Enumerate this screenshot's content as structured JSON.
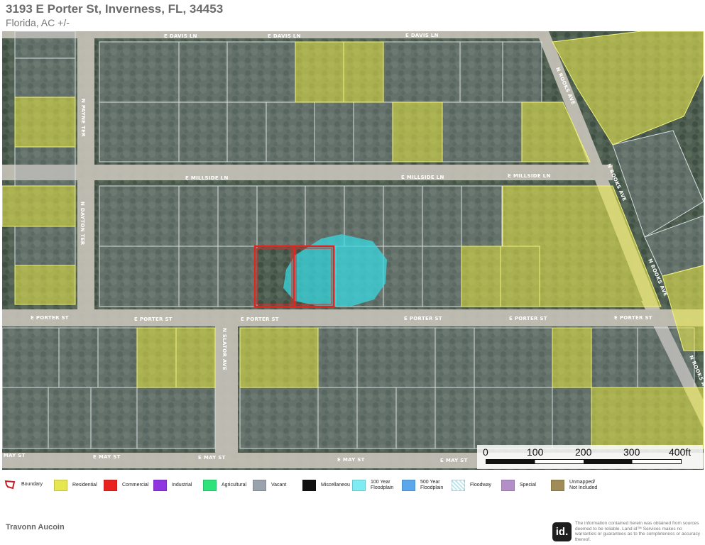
{
  "header": {
    "title": "3193 E Porter St, Inverness, FL, 34453",
    "subtitle": "Florida,  AC +/-"
  },
  "roads": {
    "davis_1": "E DAVIS LN",
    "davis_2": "E DAVIS LN",
    "davis_3": "E DAVIS LN",
    "millside_1": "E MILLSIDE LN",
    "millside_2": "E MILLSIDE LN",
    "millside_3": "E MILLSIDE LN",
    "porter_1": "E PORTER ST",
    "porter_2": "E PORTER ST",
    "porter_3": "E PORTER ST",
    "porter_4": "E PORTER ST",
    "porter_5": "E PORTER ST",
    "porter_6": "E PORTER ST",
    "may_1": "E MAY ST",
    "may_2": "E MAY ST",
    "may_3": "E MAY ST",
    "may_4": "E MAY ST",
    "payne": "N PAYNE TER",
    "dayton": "N DAYTON TER",
    "slator": "N SLATOR AVE",
    "rooks_1": "N ROOKS AVE",
    "rooks_2": "N ROOKS AVE",
    "rooks_3": "N ROOKS AVE",
    "rooks_4": "N ROOKS AVE"
  },
  "scale": {
    "ticks": [
      "0",
      "100",
      "200",
      "300",
      "400ft"
    ]
  },
  "legend": {
    "items": [
      {
        "label": "Boundary",
        "color": "#ffffff",
        "icon": "boundary-polygon-icon"
      },
      {
        "label": "Residential",
        "color": "#e6e650"
      },
      {
        "label": "Commercial",
        "color": "#e8231f"
      },
      {
        "label": "Industrial",
        "color": "#8f36e0"
      },
      {
        "label": "Agricultural",
        "color": "#2fe27a"
      },
      {
        "label": "Vacant",
        "color": "#9aa3ad"
      },
      {
        "label": "Miscellaneou",
        "color": "#111111"
      },
      {
        "label": "100 Year Floodplain",
        "color": "#7eecf2"
      },
      {
        "label": "500 Year Floodplain",
        "color": "#5aa7ec"
      },
      {
        "label": "Floodway",
        "color": "#bfe6ee",
        "icon": "hatched-pattern-icon"
      },
      {
        "label": "Special",
        "color": "#b28fc7"
      },
      {
        "label": "Unmapped/ Not Included",
        "color": "#9f8c58"
      }
    ]
  },
  "colors": {
    "boundary": "#e8231f",
    "residential": "#e6e650",
    "floodplain": "#38d8e0",
    "vacant": "#9aa3ad"
  },
  "footer": {
    "agent": "Travonn Aucoin",
    "logo": "id.",
    "disclaimer": "The information contained herein was obtained from sources deemed to be reliable. Land id™ Services makes no warranties or guarantees as to the completeness or accuracy thereof."
  }
}
